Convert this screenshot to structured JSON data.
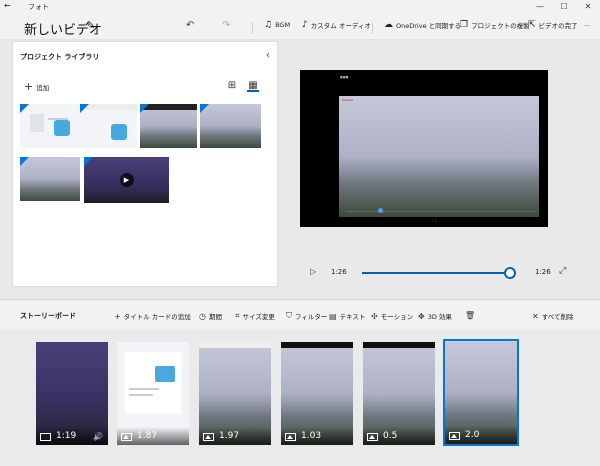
{
  "window": {
    "app_name": "フォト",
    "back_icon": "back-arrow-icon",
    "minimize_icon": "minimize-icon",
    "maximize_icon": "maximize-icon",
    "close_icon": "close-icon"
  },
  "toolbar": {
    "title": "新しいビデオ",
    "undo_icon": "undo-icon",
    "redo_icon": "redo-icon",
    "bgm": "BGM",
    "custom_audio": "カスタム オーディオ",
    "onedrive_sync": "OneDrive と同期する",
    "duplicate_project": "プロジェクトの複製",
    "finish_video": "ビデオの完了",
    "more": "..."
  },
  "library": {
    "title": "プロジェクト ライブラリ",
    "add_label": "追加",
    "collapse_icon": "chevron-left-icon",
    "items": [
      {
        "kind": "document"
      },
      {
        "kind": "screenshot"
      },
      {
        "kind": "sky"
      },
      {
        "kind": "sky"
      },
      {
        "kind": "sky"
      },
      {
        "kind": "night-video"
      }
    ]
  },
  "player": {
    "current_time": "1:26",
    "end_time": "1:26",
    "progress": 1.0
  },
  "storyboard": {
    "title": "ストーリーボード",
    "add_title_card": "タイトル カードの追加",
    "duration": "期間",
    "resize": "サイズ変更",
    "filters": "フィルター",
    "text": "テキスト",
    "motion": "モーション",
    "effects_3d": "3D 効果",
    "remove_all": "すべて削除",
    "clips": [
      {
        "kind": "video",
        "duration": "1:19",
        "theme": "night",
        "selected": false
      },
      {
        "kind": "image",
        "duration": "1.87",
        "theme": "doc",
        "selected": false
      },
      {
        "kind": "image",
        "duration": "1.97",
        "theme": "sky",
        "selected": false
      },
      {
        "kind": "image",
        "duration": "1.03",
        "theme": "sky",
        "selected": false
      },
      {
        "kind": "image",
        "duration": "0.5",
        "theme": "sky",
        "selected": false
      },
      {
        "kind": "image",
        "duration": "2.0",
        "theme": "sky",
        "selected": true
      }
    ]
  },
  "colors": {
    "accent": "#0078d7",
    "link": "#0063b1"
  }
}
